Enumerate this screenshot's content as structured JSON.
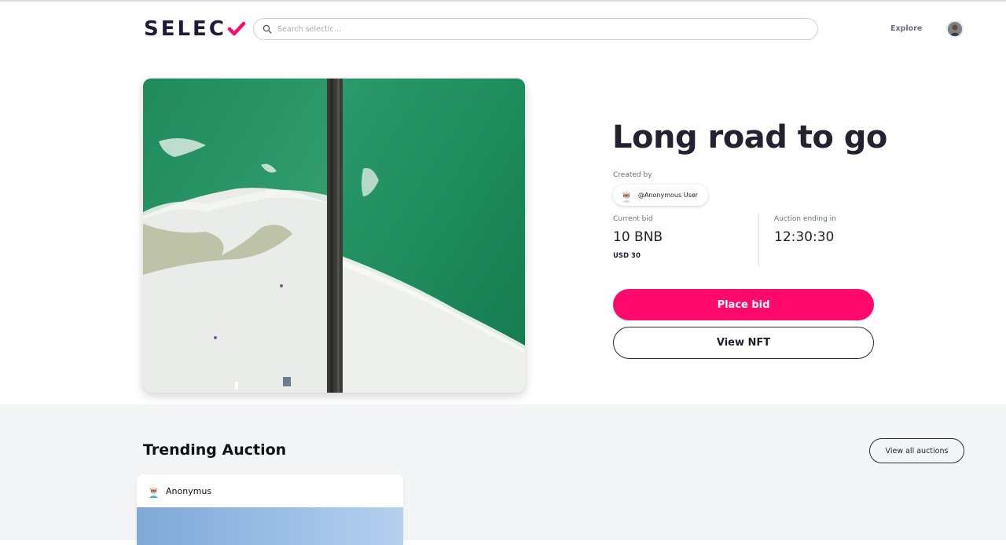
{
  "header": {
    "logo_text": "SELEC",
    "search_placeholder": "Search selectic...",
    "explore_label": "Explore"
  },
  "hero": {
    "title": "Long road to go",
    "created_by_label": "Created by",
    "creator_name": "@Anonymous User",
    "current_bid_label": "Current bid",
    "current_bid_value": "10 BNB",
    "current_bid_usd": "USD 30",
    "auction_label": "Auction ending in",
    "auction_time": "12:30:30",
    "place_bid_label": "Place bid",
    "view_nft_label": "View NFT"
  },
  "trending": {
    "title": "Trending Auction",
    "view_all_label": "View all auctions",
    "cards": [
      {
        "author": "Anonymus"
      }
    ]
  },
  "colors": {
    "accent": "#ff0a6c",
    "logo_navy": "#1c1b3a",
    "section_bg": "#f4f5f7"
  },
  "icons": {
    "search": "search-icon",
    "logo_check": "checkmark-icon"
  }
}
